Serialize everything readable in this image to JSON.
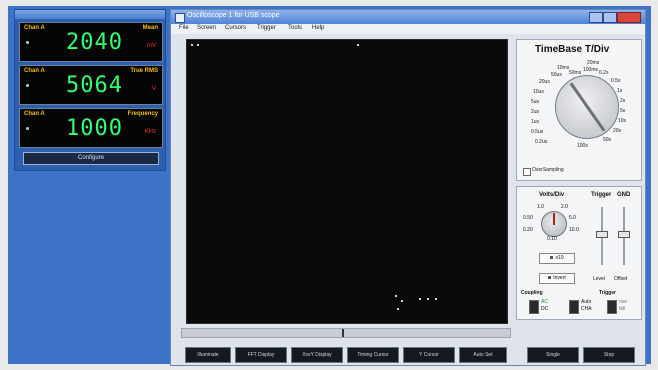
{
  "window": {
    "title": "Oscilloscope 1 for USB scope"
  },
  "menu": [
    "File",
    "Screen",
    "Cursors",
    "Trigger",
    "Tools",
    "Help"
  ],
  "meters": [
    {
      "channel": "Chan A",
      "mode": "Mean",
      "value": "2040",
      "unit": "mV"
    },
    {
      "channel": "Chan A",
      "mode": "True RMS",
      "value": "5064",
      "unit": "V"
    },
    {
      "channel": "Chan A",
      "mode": "Frequency",
      "value": "1000",
      "unit": "KHz"
    }
  ],
  "meter_panel": {
    "configure_label": "Configure"
  },
  "timebase": {
    "title": "TimeBase T/Div",
    "labels": [
      "10ms",
      "20ms",
      "50ms",
      "100ms",
      "0.2s",
      "0.5s",
      "1s",
      "2s",
      "5s",
      "10s",
      "20s",
      "50s",
      "100s",
      "0.2us",
      "0.5us",
      "1us",
      "2us",
      "5us",
      "10us",
      "20us",
      "50us"
    ],
    "oversampling_label": "OverSampling"
  },
  "volts": {
    "title": "Volts/Div",
    "trigger_label": "Trigger",
    "gnd_label": "GND",
    "knob_labels": [
      "1.0",
      "2.0",
      "5.0",
      "0.50",
      "0.20",
      "0.10",
      "10.0",
      "0.5"
    ],
    "x10_label": "x10",
    "invert_label": "Invert",
    "level_label": "Level",
    "offset_label": "Offset",
    "coupling_label": "Coupling",
    "trigger_group_label": "Trigger",
    "coupling_options": [
      "AC",
      "DC"
    ],
    "trigger_mode_options": [
      "Auto",
      "CHA"
    ],
    "trigger_edge_options": [
      "rise",
      "fall"
    ]
  },
  "bottom_buttons": [
    "Illuminate",
    "FFT Display",
    "XvsY Display",
    "Timing Cursor",
    "Y Cursor",
    "Auto Set",
    "Single",
    "Stop"
  ]
}
